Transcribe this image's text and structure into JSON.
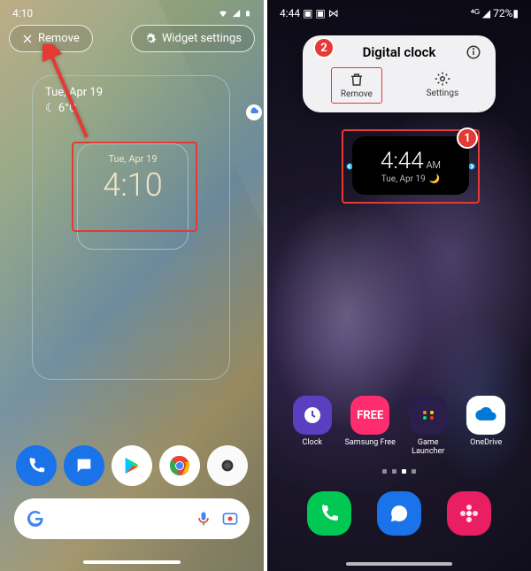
{
  "pixel": {
    "status": {
      "time": "4:10",
      "icons": "▾ ◢ ▮"
    },
    "remove_label": "Remove",
    "settings_label": "Widget settings",
    "weather": {
      "date": "Tue, Apr 19",
      "temp": "6°C",
      "cond": "☾"
    },
    "clock": {
      "date": "Tue, Apr 19",
      "time": "4:10"
    },
    "dock": [
      "phone",
      "messages",
      "play",
      "chrome",
      "camera"
    ]
  },
  "samsung": {
    "status": {
      "time": "4:44",
      "battery": "72%"
    },
    "popup": {
      "title": "Digital clock",
      "remove": "Remove",
      "settings": "Settings"
    },
    "badge1": "1",
    "badge2": "2",
    "clock": {
      "time": "4:44",
      "ampm": "AM",
      "date": "Tue, Apr 19"
    },
    "apps": [
      {
        "label": "Clock"
      },
      {
        "label": "Samsung Free"
      },
      {
        "label": "Game Launcher"
      },
      {
        "label": "OneDrive"
      }
    ]
  }
}
